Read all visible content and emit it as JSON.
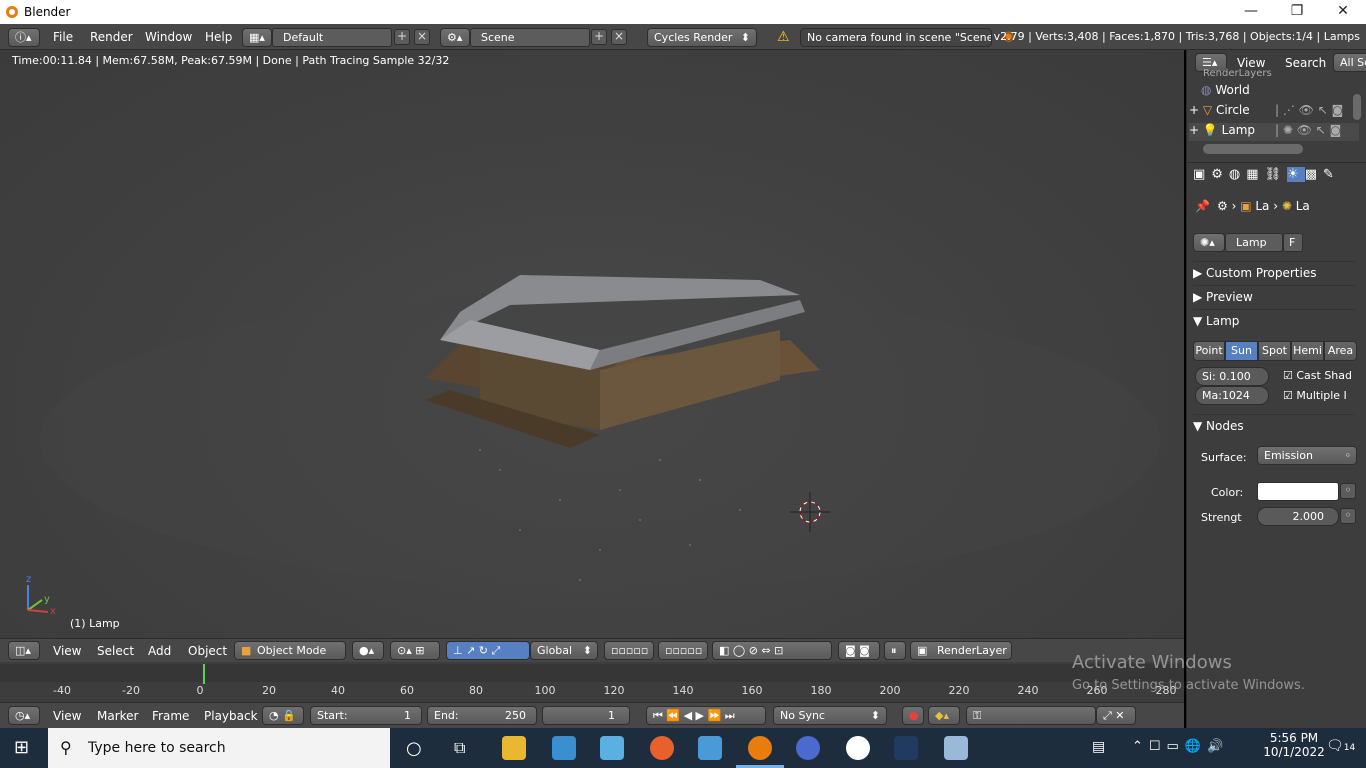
{
  "window": {
    "title": "Blender",
    "controls": {
      "minimize": "—",
      "maximize": "❐",
      "close": "✕"
    }
  },
  "info_header": {
    "menus": [
      "File",
      "Render",
      "Window",
      "Help"
    ],
    "layout": "Default",
    "scene": "Scene",
    "engine": "Cycles Render",
    "warning": "No camera found in scene \"Scene\"",
    "stats": "v2.79 | Verts:3,408 | Faces:1,870 | Tris:3,768 | Objects:1/4 | Lamps"
  },
  "viewport": {
    "render_status": "Time:00:11.84 | Mem:67.58M, Peak:67.59M | Done | Path Tracing Sample 32/32",
    "object_label": "(1) Lamp",
    "axis_x": "x",
    "axis_y": "y",
    "axis_z": "z",
    "header": {
      "menus": [
        "View",
        "Select",
        "Add",
        "Object"
      ],
      "mode": "Object Mode",
      "orientation": "Global",
      "layer": "RenderLayer"
    }
  },
  "timeline": {
    "ticks": [
      "-40",
      "-20",
      "0",
      "20",
      "40",
      "60",
      "80",
      "100",
      "120",
      "140",
      "160",
      "180",
      "200",
      "220",
      "240",
      "260",
      "280"
    ],
    "header": {
      "menus": [
        "View",
        "Marker",
        "Frame",
        "Playback"
      ],
      "start_label": "Start:",
      "start": "1",
      "end_label": "End:",
      "end": "250",
      "current": "1",
      "sync": "No Sync"
    }
  },
  "outliner": {
    "menus": [
      "View",
      "Search",
      "All Sc"
    ],
    "items": [
      {
        "name": "RenderLayers"
      },
      {
        "name": "World"
      },
      {
        "name": "Circle"
      },
      {
        "name": "Lamp"
      }
    ]
  },
  "properties": {
    "breadcrumb": [
      "La",
      "La"
    ],
    "datablock": "Lamp",
    "fake_user": "F",
    "panels": {
      "custom": "Custom Properties",
      "preview": "Preview",
      "lamp": "Lamp",
      "nodes": "Nodes"
    },
    "lamp_types": [
      "Point",
      "Sun",
      "Spot",
      "Hemi",
      "Area"
    ],
    "active_type": "Sun",
    "size": "Si: 0.100",
    "max": "Ma:1024",
    "cast_shadow": "Cast Shad",
    "multiple": "Multiple I",
    "surface_label": "Surface:",
    "surface": "Emission",
    "color_label": "Color:",
    "strength_label": "Strengt",
    "strength": "2.000"
  },
  "watermark": {
    "line1": "Activate Windows",
    "line2": "Go to Settings to activate Windows."
  },
  "taskbar": {
    "search_placeholder": "Type here to search",
    "time": "5:56 PM",
    "date": "10/1/2022",
    "notifications": "14"
  },
  "colors": {
    "accent": "#5680c2",
    "blender_orange": "#e87d0d",
    "warning": "#ffcc00"
  }
}
